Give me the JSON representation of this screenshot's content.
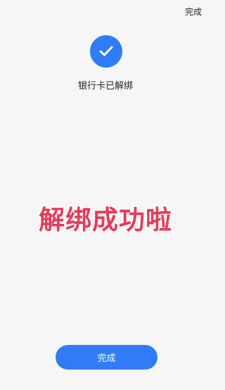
{
  "header": {
    "done_label": "完成"
  },
  "result": {
    "icon": "checkmark-icon",
    "status_text": "银行卡已解绑",
    "accent_color": "#2f7cf6"
  },
  "overlay": {
    "caption": "解绑成功啦",
    "color": "#e63b5a"
  },
  "footer": {
    "done_button_label": "完成"
  }
}
